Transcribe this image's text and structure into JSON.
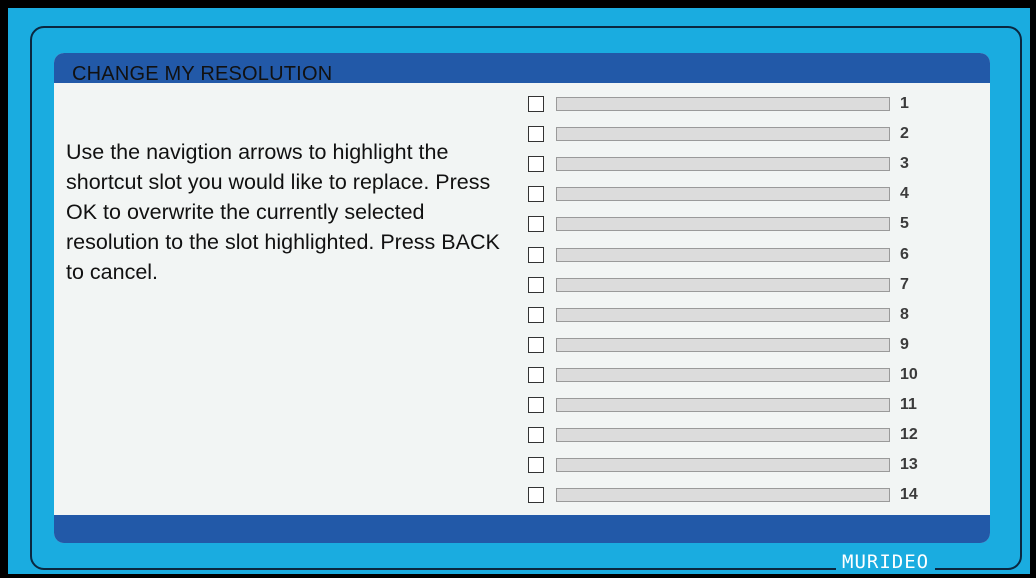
{
  "dialog": {
    "title": "CHANGE MY RESOLUTION",
    "instructions": "Use the navigtion arrows to highlight the shortcut slot you would like to replace.  Press OK to overwrite the currently selected resolution to the slot highlighted.  Press BACK to cancel."
  },
  "slots": [
    {
      "number": "1",
      "value": "",
      "checked": false
    },
    {
      "number": "2",
      "value": "",
      "checked": false
    },
    {
      "number": "3",
      "value": "",
      "checked": false
    },
    {
      "number": "4",
      "value": "",
      "checked": false
    },
    {
      "number": "5",
      "value": "",
      "checked": false
    },
    {
      "number": "6",
      "value": "",
      "checked": false
    },
    {
      "number": "7",
      "value": "",
      "checked": false
    },
    {
      "number": "8",
      "value": "",
      "checked": false
    },
    {
      "number": "9",
      "value": "",
      "checked": false
    },
    {
      "number": "10",
      "value": "",
      "checked": false
    },
    {
      "number": "11",
      "value": "",
      "checked": false
    },
    {
      "number": "12",
      "value": "",
      "checked": false
    },
    {
      "number": "13",
      "value": "",
      "checked": false
    },
    {
      "number": "14",
      "value": "",
      "checked": false
    }
  ],
  "brand": {
    "name": "MURIDEO"
  },
  "colors": {
    "frame": "#1aace0",
    "bar": "#2259a8",
    "panel": "#f2f5f4",
    "field": "#dcdcdc"
  }
}
